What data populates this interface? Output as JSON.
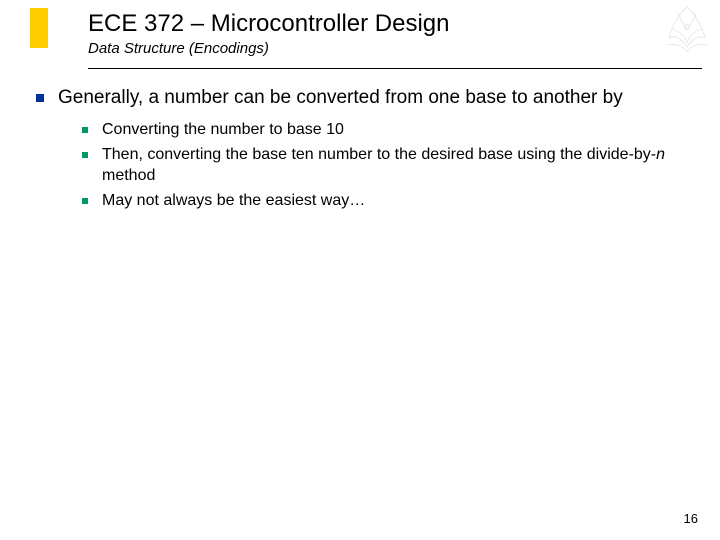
{
  "header": {
    "title": "ECE 372 – Microcontroller Design",
    "subtitle": "Data Structure (Encodings)"
  },
  "body": {
    "main_point": "Generally, a number can be converted from one base to another by",
    "sub_points": [
      "Converting the number to base 10",
      "Then, converting the base ten number to the desired base using the divide-by-",
      "May not always be the easiest way…"
    ],
    "sub_point_1_italic": "n",
    "sub_point_1_tail": " method"
  },
  "footer": {
    "page_number": "16"
  },
  "colors": {
    "accent": "#ffcc00",
    "bullet_l1": "#003399",
    "bullet_l2": "#009966"
  }
}
